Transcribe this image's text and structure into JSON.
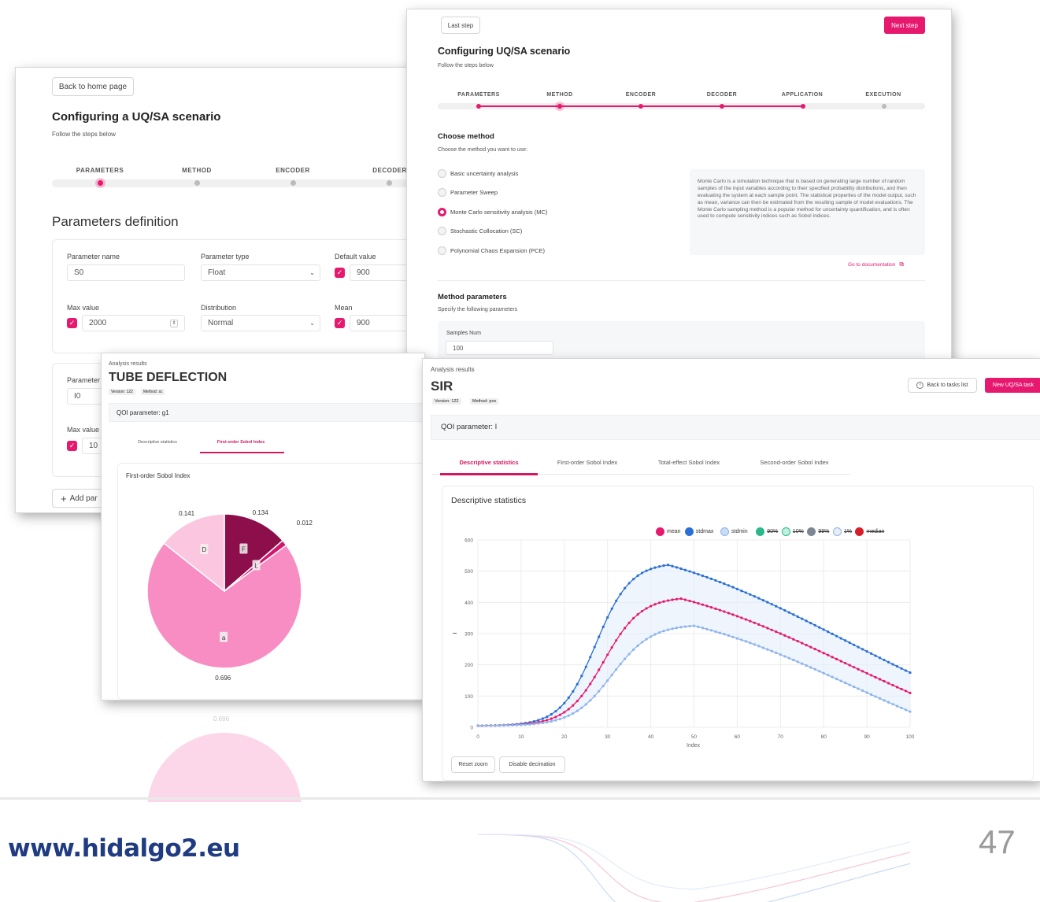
{
  "panel_params": {
    "back_button": "Back to home page",
    "title": "Configuring a UQ/SA scenario",
    "subtitle": "Follow the steps below",
    "steps": [
      "PARAMETERS",
      "METHOD",
      "ENCODER",
      "DECODER"
    ],
    "section_title": "Parameters definition",
    "param1": {
      "name_label": "Parameter name",
      "name_value": "S0",
      "type_label": "Parameter type",
      "type_value": "Float",
      "default_label": "Default value",
      "default_value": "900",
      "max_label": "Max value",
      "max_value": "2000",
      "dist_label": "Distribution",
      "dist_value": "Normal",
      "mean_label": "Mean",
      "mean_value": "900"
    },
    "param2": {
      "name_label": "Parameter",
      "name_value": "I0",
      "max_label": "Max value",
      "max_value": "10"
    },
    "add_button": "Add par"
  },
  "panel_method": {
    "last_step": "Last step",
    "next_step": "Next step",
    "title": "Configuring UQ/SA scenario",
    "subtitle": "Follow the steps below",
    "steps": [
      "PARAMETERS",
      "METHOD",
      "ENCODER",
      "DECODER",
      "APPLICATION",
      "EXECUTION"
    ],
    "choose_title": "Choose method",
    "choose_subtitle": "Choose the method you want to use:",
    "options": [
      "Basic uncertainty analysis",
      "Parameter Sweep",
      "Monte Carlo sensitivity analysis (MC)",
      "Stochastic Collocation (SC)",
      "Polynomial Chaos Expansion (PCE)"
    ],
    "selected_index": 2,
    "description": "Monte Carlo is a simulation technique that is based on generating large number of random samples of the input variables according to their specified probability distributions, and then evaluating the system at each sample point. The statistical properties of the model output, such as mean, variance can then be estimated from the resulting sample of model evaluations. The Monte Carlo sampling method is a popular method for uncertainty quantification, and is often used to compute sensitivity indices such as Sobol indices.",
    "doc_link": "Go to documentation",
    "params_title": "Method parameters",
    "params_subtitle": "Specify the following parameters",
    "samples_label": "Samples Num",
    "samples_value": "100"
  },
  "panel_tube": {
    "kicker": "Analysis results",
    "title": "TUBE DEFLECTION",
    "version": "Version: 122",
    "method": "Method: sc",
    "qoi": "QOI parameter: g1",
    "tabs": [
      "Descriptive statistics",
      "First-order Sobol Index"
    ],
    "active_tab": 1,
    "card_title": "First-order Sobol Index",
    "chart_data": {
      "type": "pie",
      "slices": [
        {
          "label": "F",
          "value": 0.134,
          "color": "#8c0f4b"
        },
        {
          "label": "L",
          "value": 0.012,
          "color": "#d2186c"
        },
        {
          "label": "a",
          "value": 0.696,
          "color": "#f78dc2"
        },
        {
          "label": "D",
          "value": 0.141,
          "color": "#fbc6df"
        }
      ]
    }
  },
  "panel_sir": {
    "kicker": "Analysis results",
    "title": "SIR",
    "version": "Version: 122",
    "method": "Method: pce",
    "back_button": "Back to tasks list",
    "new_button": "New UQ/SA task",
    "qoi": "QOI parameter: I",
    "tabs": [
      "Descriptive statistics",
      "First-order Sobol Index",
      "Total-effect Sobol Index",
      "Second-order Sobol Index"
    ],
    "active_tab": 0,
    "card_title": "Descriptive statistics",
    "reset_zoom": "Reset zoom",
    "disable_decimation": "Disable decimation",
    "chart_data": {
      "type": "line",
      "xlabel": "Index",
      "xlim": [
        0,
        100
      ],
      "ylim": [
        0,
        600
      ],
      "xticks": [
        0,
        10,
        20,
        30,
        40,
        50,
        60,
        70,
        80,
        90,
        100
      ],
      "yticks": [
        0,
        100,
        200,
        300,
        400,
        500,
        600
      ],
      "legend": [
        {
          "name": "mean",
          "color": "#e6196e",
          "hidden": false
        },
        {
          "name": "stdmax",
          "color": "#2a6fd6",
          "hidden": false
        },
        {
          "name": "stdmin",
          "color": "#c9dcf5",
          "hidden": false
        },
        {
          "name": "90%",
          "color": "#2ab88a",
          "hidden": true
        },
        {
          "name": "10%",
          "color": "#bff0e0",
          "hidden": true
        },
        {
          "name": "99%",
          "color": "#7c8794",
          "hidden": true
        },
        {
          "name": "1%",
          "color": "#e9edf3",
          "hidden": true
        },
        {
          "name": "median",
          "color": "#d91c2a",
          "hidden": true
        }
      ],
      "series": [
        {
          "name": "stdmax",
          "peak_x": 44,
          "peak_y": 520,
          "end_y": 175,
          "color": "#2a6fd6"
        },
        {
          "name": "mean",
          "peak_x": 47,
          "peak_y": 412,
          "end_y": 110,
          "color": "#e6196e"
        },
        {
          "name": "stdmin",
          "peak_x": 50,
          "peak_y": 325,
          "end_y": 50,
          "color": "#8eb4ec"
        }
      ]
    }
  },
  "footer": {
    "url": "www.hidalgo2.eu",
    "page_number": "47"
  }
}
